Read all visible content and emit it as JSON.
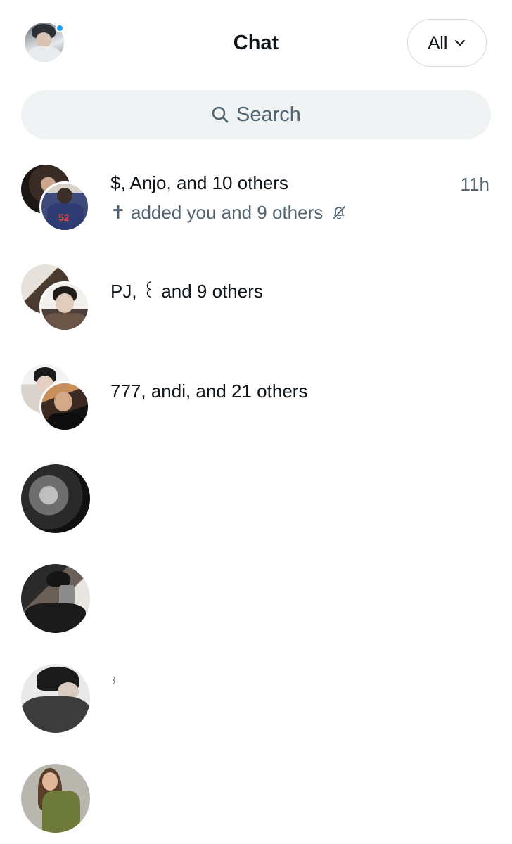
{
  "header": {
    "title": "Chat",
    "filter_label": "All",
    "profile_icon": "user-avatar",
    "has_notification": true
  },
  "search": {
    "placeholder": "Search",
    "icon": "search-icon"
  },
  "conversations": [
    {
      "title": "$, Anjo, and 10 others",
      "subtitle": "✝ added you and 9 others",
      "time": "11h",
      "muted": true,
      "avatar_type": "group"
    },
    {
      "title": "PJ, ꒰ and 9 others",
      "subtitle": "",
      "time": "",
      "muted": false,
      "avatar_type": "group"
    },
    {
      "title": "777, andi, and 21 others",
      "subtitle": "",
      "time": "",
      "muted": false,
      "avatar_type": "group"
    },
    {
      "title": "",
      "subtitle": "",
      "time": "",
      "muted": false,
      "avatar_type": "single"
    },
    {
      "title": "",
      "subtitle": "",
      "time": "",
      "muted": false,
      "avatar_type": "single"
    },
    {
      "title": "꒱",
      "subtitle": "",
      "time": "",
      "muted": false,
      "avatar_type": "single"
    },
    {
      "title": "",
      "subtitle": "",
      "time": "",
      "muted": false,
      "avatar_type": "single"
    }
  ],
  "colors": {
    "accent": "#1d9bf0",
    "text_primary": "#0f1419",
    "text_secondary": "#536471",
    "search_bg": "#eff3f4",
    "border": "#cfd9de"
  }
}
